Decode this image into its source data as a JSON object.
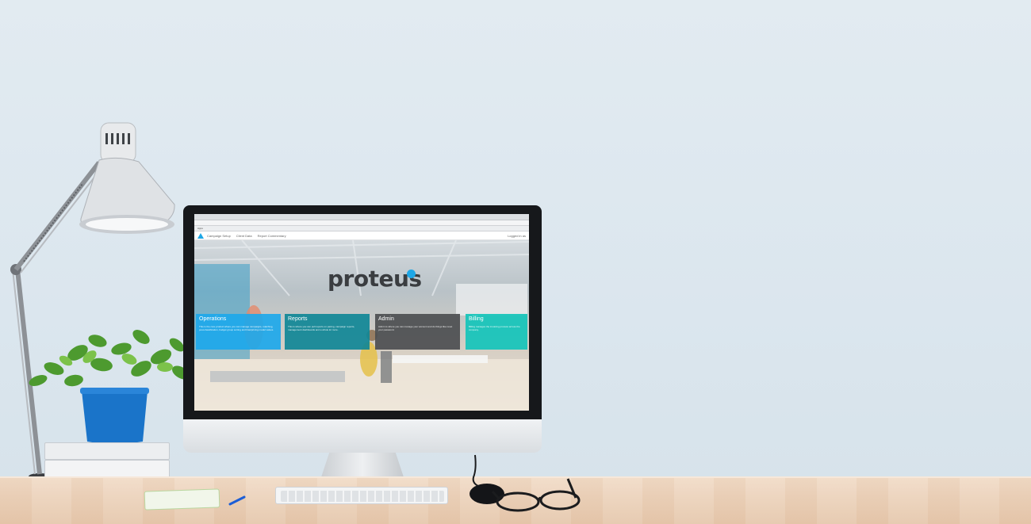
{
  "browser": {
    "url": "",
    "bookmarks": [
      "Apps",
      "",
      "",
      "",
      "",
      "",
      "",
      "",
      "",
      "",
      "",
      "",
      "",
      "",
      "",
      "",
      ""
    ]
  },
  "app_nav": {
    "links": [
      "Campaign Setup",
      "Client Data",
      "Report Commentary"
    ],
    "login_text": "Logged in as"
  },
  "brand": {
    "name": "proteus",
    "dot_color": "#1ea7e6"
  },
  "tiles": [
    {
      "title": "Operations",
      "description": "This is the core product where you can manage campaigns, matching, post-classification, budget group sorting and bias/pricing model values.",
      "color": "#1da8ea"
    },
    {
      "title": "Reports",
      "description": "This is where you can pull reports on pacing, campaign reports, management dashboards and a whole lot more.",
      "color": "#108796"
    },
    {
      "title": "Admin",
      "description": "Admin is where you can manage your account and do things like reset your password.",
      "color": "#4c4e50"
    },
    {
      "title": "Billing",
      "description": "Billing manages the invoicing process across the company.",
      "color": "#14c4ba"
    }
  ]
}
